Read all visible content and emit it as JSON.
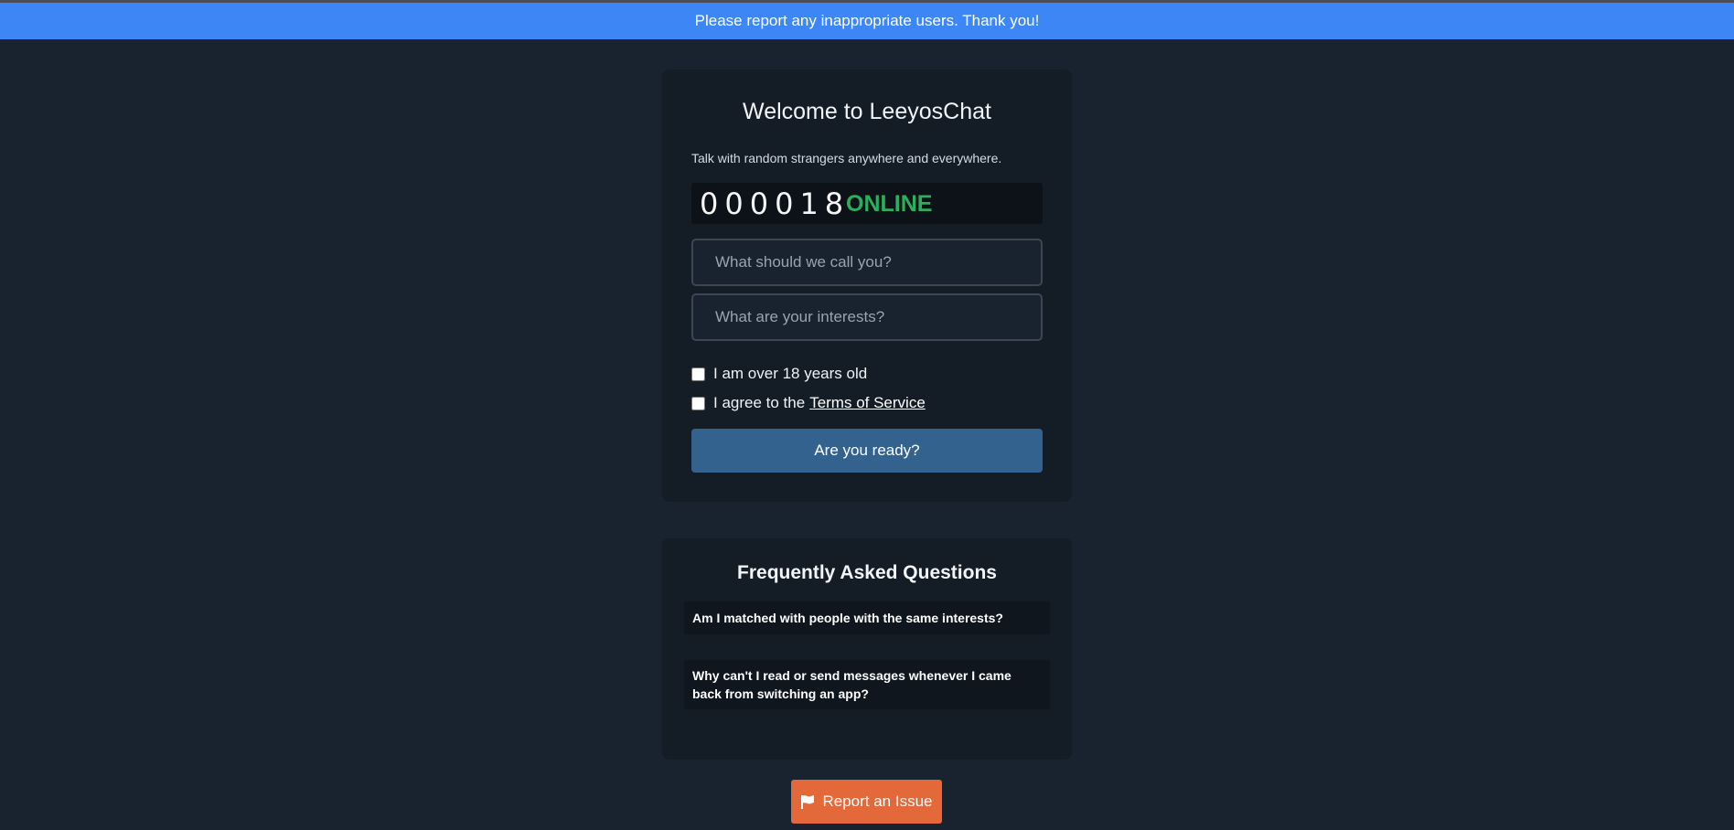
{
  "banner": {
    "text": "Please report any inappropriate users. Thank you!"
  },
  "welcome": {
    "title": "Welcome to LeeyosChat",
    "subtitle": "Talk with random strangers anywhere and everywhere.",
    "online_count": "000018",
    "online_label": "ONLINE",
    "name_placeholder": "What should we call you?",
    "interests_placeholder": "What are your interests?",
    "age_label": "I am over 18 years old",
    "age_checked": false,
    "tos_prefix": "I agree to the",
    "tos_link": "Terms of Service",
    "tos_checked": false,
    "ready_button": "Are you ready?"
  },
  "faq": {
    "title": "Frequently Asked Questions",
    "items": [
      {
        "question": "Am I matched with people with the same interests?"
      },
      {
        "question": "Why can't I read or send messages whenever I came back from switching an app?"
      }
    ]
  },
  "report": {
    "label": "Report an Issue",
    "icon": "flag-icon"
  },
  "colors": {
    "background": "#19232f",
    "banner": "#3d86f5",
    "card": "#141c25",
    "online": "#2bae5f",
    "primary_button": "#33628f",
    "report_button": "#e3683a"
  }
}
